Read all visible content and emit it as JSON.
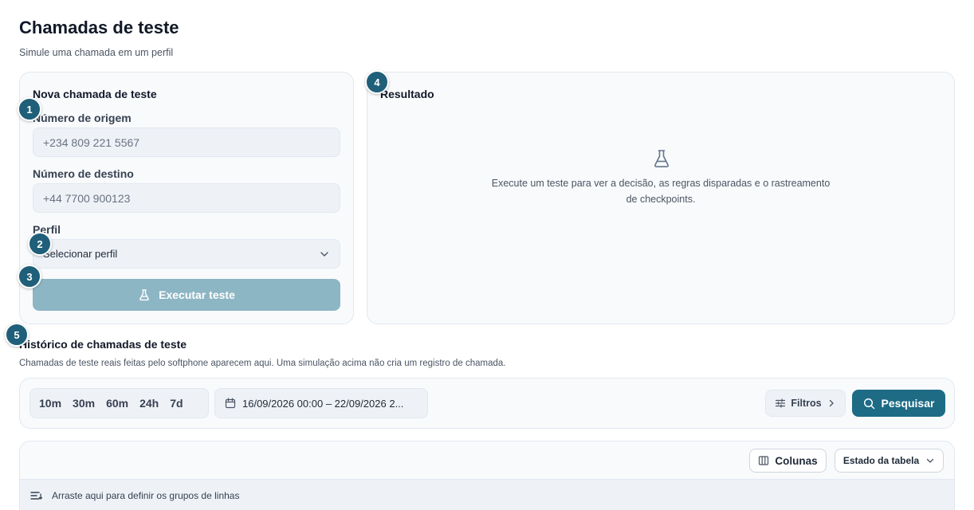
{
  "header": {
    "title": "Chamadas de teste",
    "subtitle": "Simule uma chamada em um perfil"
  },
  "new_call": {
    "title": "Nova chamada de teste",
    "origin_label": "Número de origem",
    "origin_placeholder": "+234 809 221 5567",
    "destination_label": "Número de destino",
    "destination_placeholder": "+44 7700 900123",
    "profile_label": "Perfil",
    "profile_selected": "Selecionar perfil",
    "run_label": "Executar teste"
  },
  "result": {
    "title": "Resultado",
    "empty_message": "Execute um teste para ver a decisão, as regras disparadas e o rastreamento de checkpoints."
  },
  "history": {
    "title": "Histórico de chamadas de teste",
    "subtitle": "Chamadas de teste reais feitas pelo softphone aparecem aqui. Uma simulação acima não cria um registro de chamada.",
    "ranges": [
      "10m",
      "30m",
      "60m",
      "24h",
      "7d"
    ],
    "date_range": "16/09/2026 00:00 – 22/09/2026 2...",
    "filters_label": "Filtros",
    "search_label": "Pesquisar"
  },
  "table": {
    "columns_label": "Colunas",
    "state_label": "Estado da tabela",
    "group_hint": "Arraste aqui para definir os grupos de linhas"
  },
  "badges": [
    "1",
    "2",
    "3",
    "4",
    "5"
  ],
  "colors": {
    "accent": "#1d6b85",
    "badge": "#1f5f79",
    "run_disabled": "#8db6c4",
    "card_bg": "#f8fafc"
  },
  "icons": {
    "run": "flask-icon",
    "empty": "flask-icon",
    "date": "calendar-icon",
    "filters": "sliders-icon",
    "search": "search-icon",
    "columns": "columns-icon",
    "group": "group-rows-icon"
  }
}
